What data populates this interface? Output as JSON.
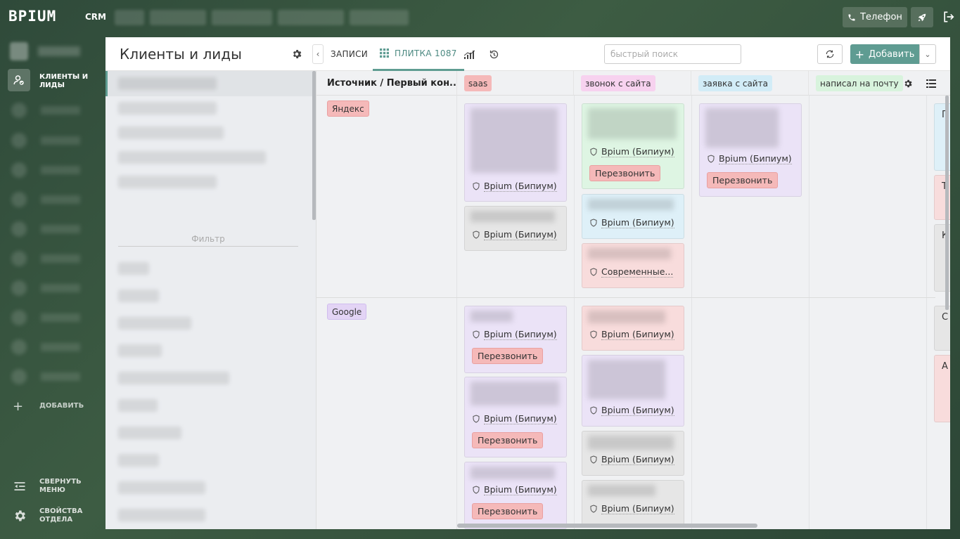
{
  "app": {
    "logo": "BPIUM",
    "section": "CRM"
  },
  "topbar": {
    "phone_label": "Телефон"
  },
  "sidebar": {
    "active_item": "КЛИЕНТЫ И ЛИДЫ",
    "add_label": "ДОБАВИТЬ",
    "collapse_label": "СВЕРНУТЬ МЕНЮ",
    "dept_settings_label": "СВОЙСТВА ОТДЕЛА"
  },
  "left_pane": {
    "title": "Клиенты и лиды",
    "filter_label": "Фильтр"
  },
  "toolbar": {
    "tabs": [
      {
        "label": "ЗАПИСИ"
      },
      {
        "label": "ПЛИТКА 1087"
      }
    ],
    "search_placeholder": "быстрый поиск",
    "add_label": "Добавить"
  },
  "board": {
    "row_header": "Источник / Первый кон...",
    "columns": [
      {
        "label": "saas",
        "color": "#f5b9b9"
      },
      {
        "label": "звонок с сайта",
        "color": "#f7d2ef"
      },
      {
        "label": "заявка с сайта",
        "color": "#d2ecf7"
      },
      {
        "label": "написал на почту",
        "color": "#d8f3dd"
      }
    ],
    "rows": [
      {
        "label": "Яндекс",
        "color": "#f5b9b9"
      },
      {
        "label": "Google",
        "color": "#e3d4f5"
      }
    ],
    "owner_name": "Bpium (Бипиум)",
    "owner_alt": "Современные...",
    "call_label": "Перезвонить",
    "edge_letters": [
      "П",
      "Т",
      "К",
      "С",
      "А"
    ]
  }
}
